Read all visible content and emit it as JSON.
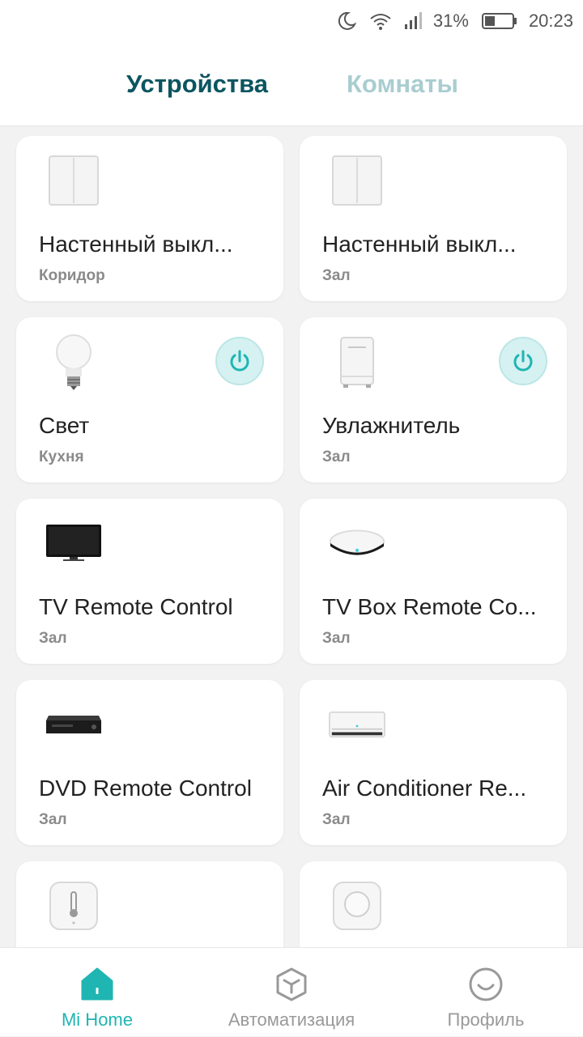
{
  "status": {
    "battery": "31%",
    "time": "20:23"
  },
  "tabs": {
    "devices": "Устройства",
    "rooms": "Комнаты"
  },
  "devices": [
    {
      "name": "Настенный выкл...",
      "room": "Коридор",
      "icon": "wall-switch-icon",
      "power": false
    },
    {
      "name": "Настенный выкл...",
      "room": "Зал",
      "icon": "wall-switch-icon",
      "power": false
    },
    {
      "name": "Свет",
      "room": "Кухня",
      "icon": "light-bulb-icon",
      "power": true
    },
    {
      "name": "Увлажнитель",
      "room": "Зал",
      "icon": "humidifier-icon",
      "power": true
    },
    {
      "name": "TV Remote Control",
      "room": "Зал",
      "icon": "tv-icon",
      "power": false
    },
    {
      "name": "TV Box Remote Co...",
      "room": "Зал",
      "icon": "ir-hub-icon",
      "power": false
    },
    {
      "name": "DVD Remote Control",
      "room": "Зал",
      "icon": "dvd-player-icon",
      "power": false
    },
    {
      "name": "Air Conditioner Re...",
      "room": "Зал",
      "icon": "air-conditioner-icon",
      "power": false
    },
    {
      "name": "",
      "room": "",
      "icon": "temperature-sensor-icon",
      "power": false
    },
    {
      "name": "",
      "room": "",
      "icon": "wireless-button-icon",
      "power": false
    }
  ],
  "nav": {
    "home": "Mi Home",
    "automation": "Автоматизация",
    "profile": "Профиль"
  },
  "colors": {
    "accent": "#1fb5b2",
    "active_tab": "#0b5560",
    "inactive_tab": "#a9cdd0"
  }
}
